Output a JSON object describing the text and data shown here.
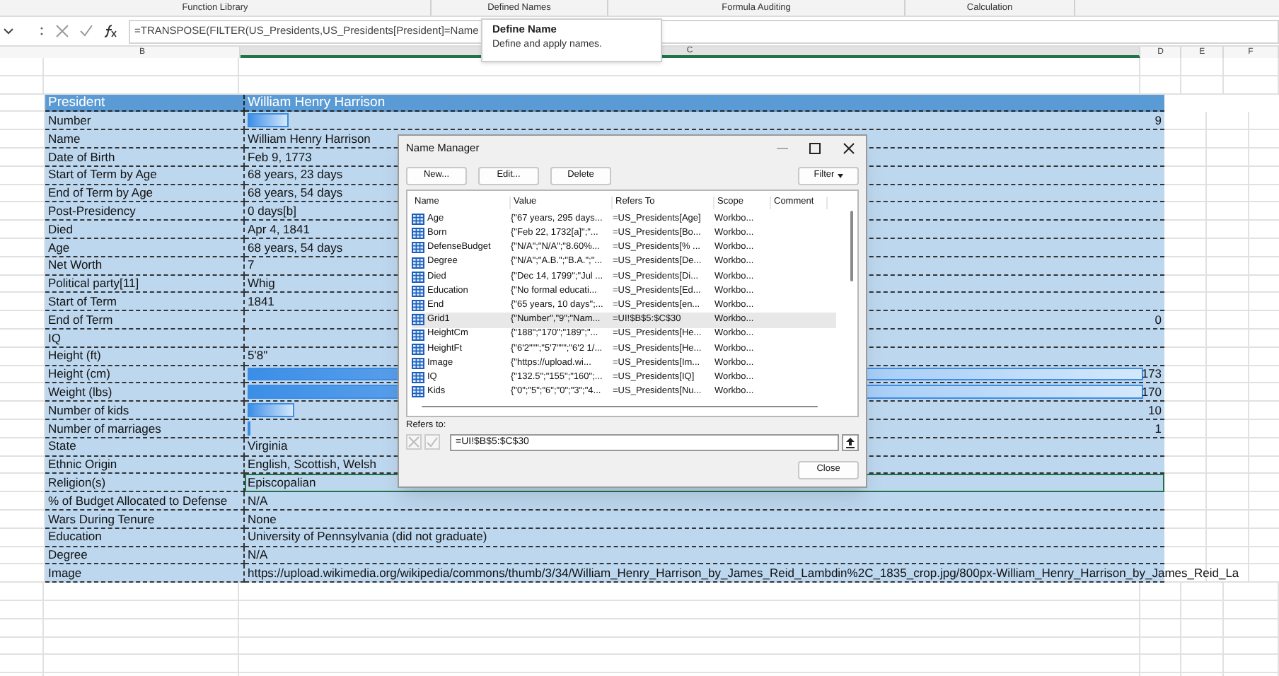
{
  "ribbon_groups": [
    "Function Library",
    "Defined Names",
    "Formula Auditing",
    "Calculation"
  ],
  "formula_bar": {
    "formula": "=TRANSPOSE(FILTER(US_Presidents,US_Presidents[President]=Name"
  },
  "tooltip": {
    "title": "Define Name",
    "description": "Define and apply names."
  },
  "columns": [
    "B",
    "C",
    "D",
    "E",
    "F"
  ],
  "table": {
    "header": {
      "label": "President",
      "value": "William Henry Harrison"
    },
    "rows": [
      {
        "label": "Number",
        "value": "9",
        "kind": "bar",
        "level": 0.05,
        "selected": false
      },
      {
        "label": "Name",
        "value": "William Henry Harrison",
        "kind": "text",
        "selected": false
      },
      {
        "label": "Date of Birth",
        "value": "Feb 9, 1773",
        "kind": "text",
        "selected": false
      },
      {
        "label": "Start of Term by Age",
        "value": "68 years, 23 days",
        "kind": "text",
        "selected": false
      },
      {
        "label": "End of Term by Age",
        "value": "68 years, 54 days",
        "kind": "text",
        "selected": false
      },
      {
        "label": "Post-Presidency",
        "value": "0 days[b]",
        "kind": "text",
        "selected": false
      },
      {
        "label": "Died",
        "value": "Apr 4, 1841",
        "kind": "text",
        "selected": false
      },
      {
        "label": "Age",
        "value": "68 years, 54 days",
        "kind": "text",
        "selected": false
      },
      {
        "label": "Net Worth",
        "value": "7",
        "kind": "text",
        "selected": false
      },
      {
        "label": "Political party[11]",
        "value": "Whig",
        "kind": "text",
        "selected": false
      },
      {
        "label": "Start of Term",
        "value": "1841",
        "kind": "text",
        "selected": false
      },
      {
        "label": "End of Term",
        "value": "0",
        "kind": "number",
        "selected": false
      },
      {
        "label": "IQ",
        "kind": "text",
        "selected": false
      },
      {
        "label": "Height (ft)",
        "value": "5'8\"",
        "kind": "text",
        "selected": false
      },
      {
        "label": "Height (cm)",
        "value": "173",
        "kind": "bar",
        "level": 0.98,
        "selected": false
      },
      {
        "label": "Weight (lbs)",
        "value": "170",
        "kind": "bar",
        "level": 0.98,
        "selected": false
      },
      {
        "label": "Number of kids",
        "value": "10",
        "kind": "bar",
        "level": 0.057,
        "selected": false
      },
      {
        "label": "Number of marriages",
        "value": "1",
        "kind": "bar",
        "level": 0.006,
        "selected": false
      },
      {
        "label": "State",
        "value": "Virginia",
        "kind": "text",
        "selected": false
      },
      {
        "label": "Ethnic Origin",
        "value": "English, Scottish, Welsh",
        "kind": "text",
        "selected": false
      },
      {
        "label": "Religion(s)",
        "value": "Episcopalian",
        "kind": "text",
        "selected": true
      },
      {
        "label": "% of Budget Allocated to Defense",
        "value": "N/A",
        "kind": "text",
        "selected": false
      },
      {
        "label": "Wars During Tenure",
        "value": "None",
        "kind": "text",
        "selected": false
      },
      {
        "label": "Education",
        "value": "University of Pennsylvania (did not graduate)",
        "kind": "text",
        "selected": false
      },
      {
        "label": "Degree",
        "value": "N/A",
        "kind": "text",
        "selected": false
      },
      {
        "label": "Image",
        "value": "https://upload.wikimedia.org/wikipedia/commons/thumb/3/34/William_Henry_Harrison_by_James_Reid_Lambdin%2C_1835_crop.jpg/800px-William_Henry_Harrison_by_James_Reid_La",
        "kind": "text",
        "selected": false
      }
    ]
  },
  "dialog": {
    "title": "Name Manager",
    "buttons": [
      "New...",
      "Edit...",
      "Delete"
    ],
    "filter_button": "Filter",
    "list_columns": [
      "Name",
      "Value",
      "Refers To",
      "Scope",
      "Comment"
    ],
    "names": [
      {
        "name": "Age",
        "value": "{\"67 years, 295 days...",
        "refers_to": "=US_Presidents[Age]",
        "scope": "Workbo...",
        "selected": false
      },
      {
        "name": "Born",
        "value": "{\"Feb 22, 1732[a]\";\"...",
        "refers_to": "=US_Presidents[Bo...",
        "scope": "Workbo...",
        "selected": false
      },
      {
        "name": "DefenseBudget",
        "value": "{\"N/A\";\"N/A\";\"8.60%...",
        "refers_to": "=US_Presidents[% ...",
        "scope": "Workbo...",
        "selected": false
      },
      {
        "name": "Degree",
        "value": "{\"N/A\";\"A.B.\";\"B.A.\";\"...",
        "refers_to": "=US_Presidents[De...",
        "scope": "Workbo...",
        "selected": false
      },
      {
        "name": "Died",
        "value": "{\"Dec 14, 1799\";\"Jul ...",
        "refers_to": "=US_Presidents[Di...",
        "scope": "Workbo...",
        "selected": false
      },
      {
        "name": "Education",
        "value": "{\"No formal educati...",
        "refers_to": "=US_Presidents[Ed...",
        "scope": "Workbo...",
        "selected": false
      },
      {
        "name": "End",
        "value": "{\"65 years, 10 days\";...",
        "refers_to": "=US_Presidents[en...",
        "scope": "Workbo...",
        "selected": false
      },
      {
        "name": "Grid1",
        "value": "{\"Number\",\"9\";\"Nam...",
        "refers_to": "=UI!$B$5:$C$30",
        "scope": "Workbo...",
        "selected": true
      },
      {
        "name": "HeightCm",
        "value": "{\"188\";\"170\";\"189\";\"...",
        "refers_to": "=US_Presidents[He...",
        "scope": "Workbo...",
        "selected": false
      },
      {
        "name": "HeightFt",
        "value": "{\"6'2\"\"\";\"5'7\"\"\";\"6'2 1/...",
        "refers_to": "=US_Presidents[He...",
        "scope": "Workbo...",
        "selected": false
      },
      {
        "name": "Image",
        "value": "{\"https://upload.wi...",
        "refers_to": "=US_Presidents[Im...",
        "scope": "Workbo...",
        "selected": false
      },
      {
        "name": "IQ",
        "value": "{\"132.5\";\"155\";\"160\";...",
        "refers_to": "=US_Presidents[IQ]",
        "scope": "Workbo...",
        "selected": false
      },
      {
        "name": "Kids",
        "value": "{\"0\";\"5\";\"6\";\"0\";\"3\";\"4...",
        "refers_to": "=US_Presidents[Nu...",
        "scope": "Workbo...",
        "selected": false
      }
    ],
    "refers_to_label": "Refers to:",
    "refers_to_value": "=UI!$B$5:$C$30",
    "close_button": "Close"
  }
}
